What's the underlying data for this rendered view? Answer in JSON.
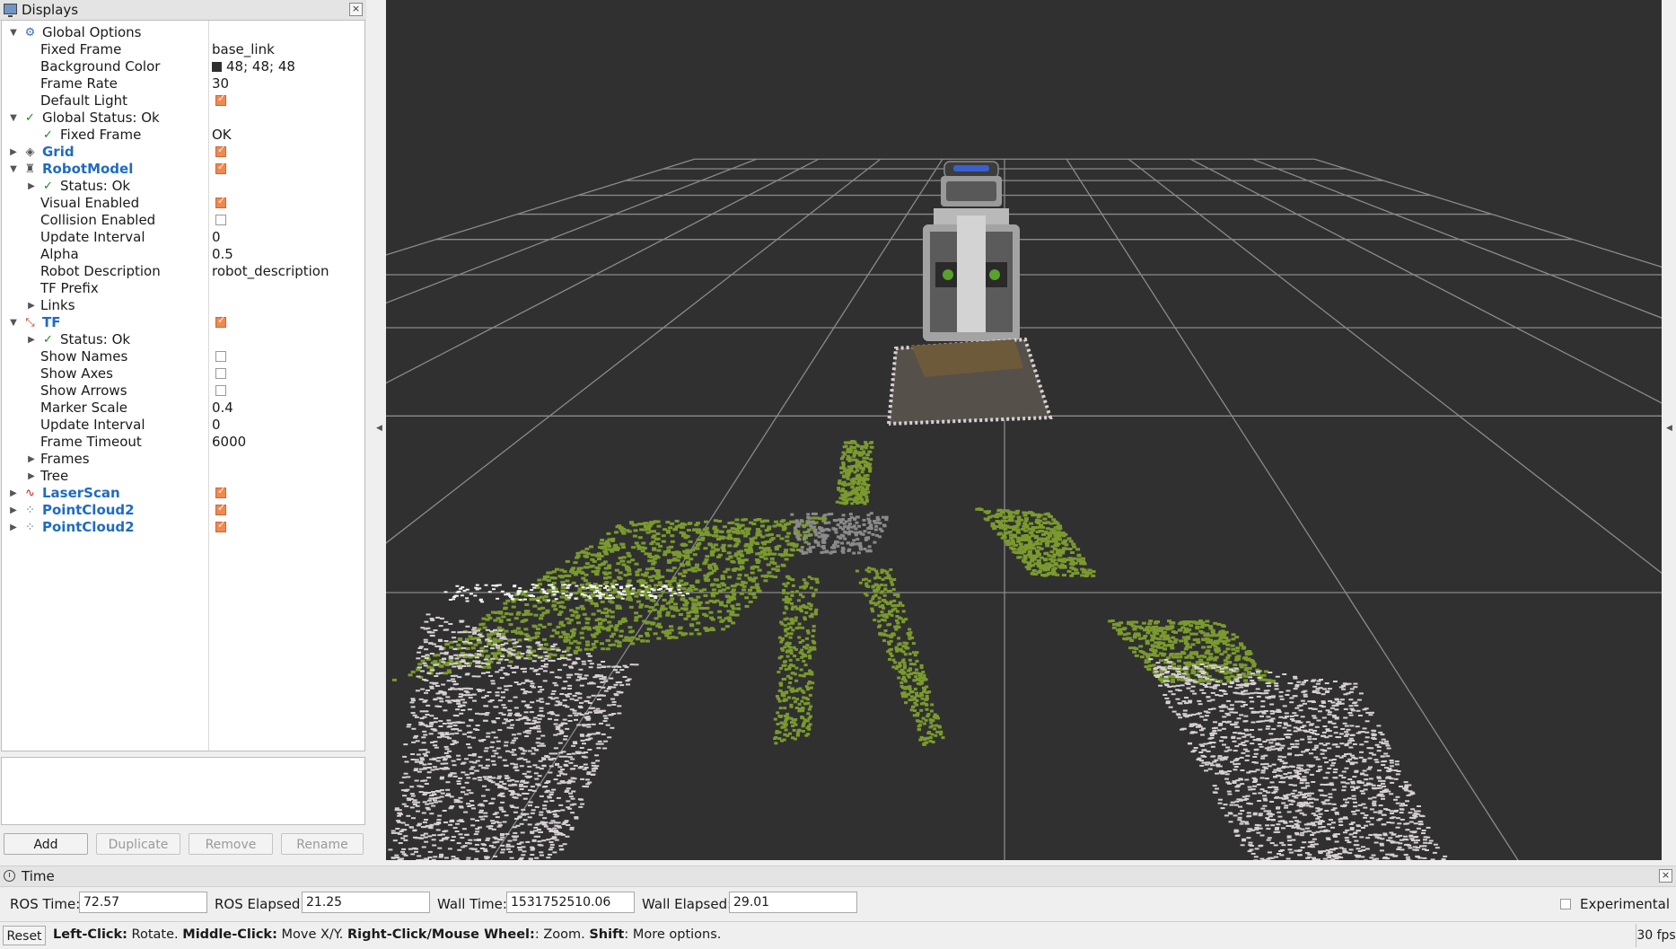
{
  "displays_panel": {
    "title": "Displays",
    "buttons": {
      "add": "Add",
      "duplicate": "Duplicate",
      "remove": "Remove",
      "rename": "Rename"
    },
    "rows": [
      {
        "level": 0,
        "expander": "expanded",
        "icon": "gear-icon",
        "label": "Global Options",
        "bold": false
      },
      {
        "level": 1,
        "label": "Fixed Frame",
        "value": "base_link"
      },
      {
        "level": 1,
        "label": "Background Color",
        "value": "48; 48; 48",
        "swatch": "#303030"
      },
      {
        "level": 1,
        "label": "Frame Rate",
        "value": "30"
      },
      {
        "level": 1,
        "label": "Default Light",
        "checkbox": true
      },
      {
        "level": 0,
        "expander": "expanded",
        "icon": "check-icon",
        "label": "Global Status: Ok"
      },
      {
        "level": 1,
        "icon": "check-icon",
        "label": "Fixed Frame",
        "value": "OK"
      },
      {
        "level": 0,
        "expander": "collapsed",
        "icon": "grid-icon",
        "label": "Grid",
        "blue": true,
        "checkbox": true
      },
      {
        "level": 0,
        "expander": "expanded",
        "icon": "robot-icon",
        "label": "RobotModel",
        "blue": true,
        "checkbox": true
      },
      {
        "level": 1,
        "expander": "collapsed",
        "icon": "check-icon",
        "label": "Status: Ok"
      },
      {
        "level": 1,
        "label": "Visual Enabled",
        "checkbox": true
      },
      {
        "level": 1,
        "label": "Collision Enabled",
        "checkbox": false
      },
      {
        "level": 1,
        "label": "Update Interval",
        "value": "0"
      },
      {
        "level": 1,
        "label": "Alpha",
        "value": "0.5"
      },
      {
        "level": 1,
        "label": "Robot Description",
        "value": "robot_description"
      },
      {
        "level": 1,
        "label": "TF Prefix",
        "value": ""
      },
      {
        "level": 1,
        "expander": "collapsed",
        "label": "Links"
      },
      {
        "level": 0,
        "expander": "expanded",
        "icon": "axes-icon",
        "label": "TF",
        "blue": true,
        "checkbox": true
      },
      {
        "level": 1,
        "expander": "collapsed",
        "icon": "check-icon",
        "label": "Status: Ok"
      },
      {
        "level": 1,
        "label": "Show Names",
        "checkbox": false
      },
      {
        "level": 1,
        "label": "Show Axes",
        "checkbox": false
      },
      {
        "level": 1,
        "label": "Show Arrows",
        "checkbox": false
      },
      {
        "level": 1,
        "label": "Marker Scale",
        "value": "0.4"
      },
      {
        "level": 1,
        "label": "Update Interval",
        "value": "0"
      },
      {
        "level": 1,
        "label": "Frame Timeout",
        "value": "6000"
      },
      {
        "level": 1,
        "expander": "collapsed",
        "label": "Frames"
      },
      {
        "level": 1,
        "expander": "collapsed",
        "label": "Tree"
      },
      {
        "level": 0,
        "expander": "collapsed",
        "icon": "laserscan-icon",
        "label": "LaserScan",
        "blue": true,
        "checkbox": true
      },
      {
        "level": 0,
        "expander": "collapsed",
        "icon": "pointcloud-icon",
        "label": "PointCloud2",
        "blue": true,
        "checkbox": true
      },
      {
        "level": 0,
        "expander": "collapsed",
        "icon": "pointcloud-icon",
        "label": "PointCloud2",
        "blue": true,
        "checkbox": true
      }
    ]
  },
  "time_panel": {
    "title": "Time",
    "ros_time_label": "ROS Time:",
    "ros_time": "72.57",
    "ros_elapsed_label": "ROS Elapsed:",
    "ros_elapsed": "21.25",
    "wall_time_label": "Wall Time:",
    "wall_time": "1531752510.06",
    "wall_elapsed_label": "Wall Elapsed:",
    "wall_elapsed": "29.01",
    "experimental_label": "Experimental",
    "experimental_checked": false
  },
  "status_bar": {
    "reset_label": "Reset",
    "help": [
      {
        "text": "Left-Click:",
        "bold": true
      },
      {
        "text": " Rotate. ",
        "bold": false
      },
      {
        "text": "Middle-Click:",
        "bold": true
      },
      {
        "text": " Move X/Y. ",
        "bold": false
      },
      {
        "text": "Right-Click/Mouse Wheel:",
        "bold": true
      },
      {
        "text": ": Zoom. ",
        "bold": false
      },
      {
        "text": "Shift",
        "bold": true
      },
      {
        "text": ": More options.",
        "bold": false
      }
    ],
    "fps": "30 fps"
  },
  "view3d": {
    "background": "#303030",
    "grid_color": "#8a8a8a",
    "cloud_green": "#7a9a2e",
    "cloud_white": "#d8d0d4"
  }
}
